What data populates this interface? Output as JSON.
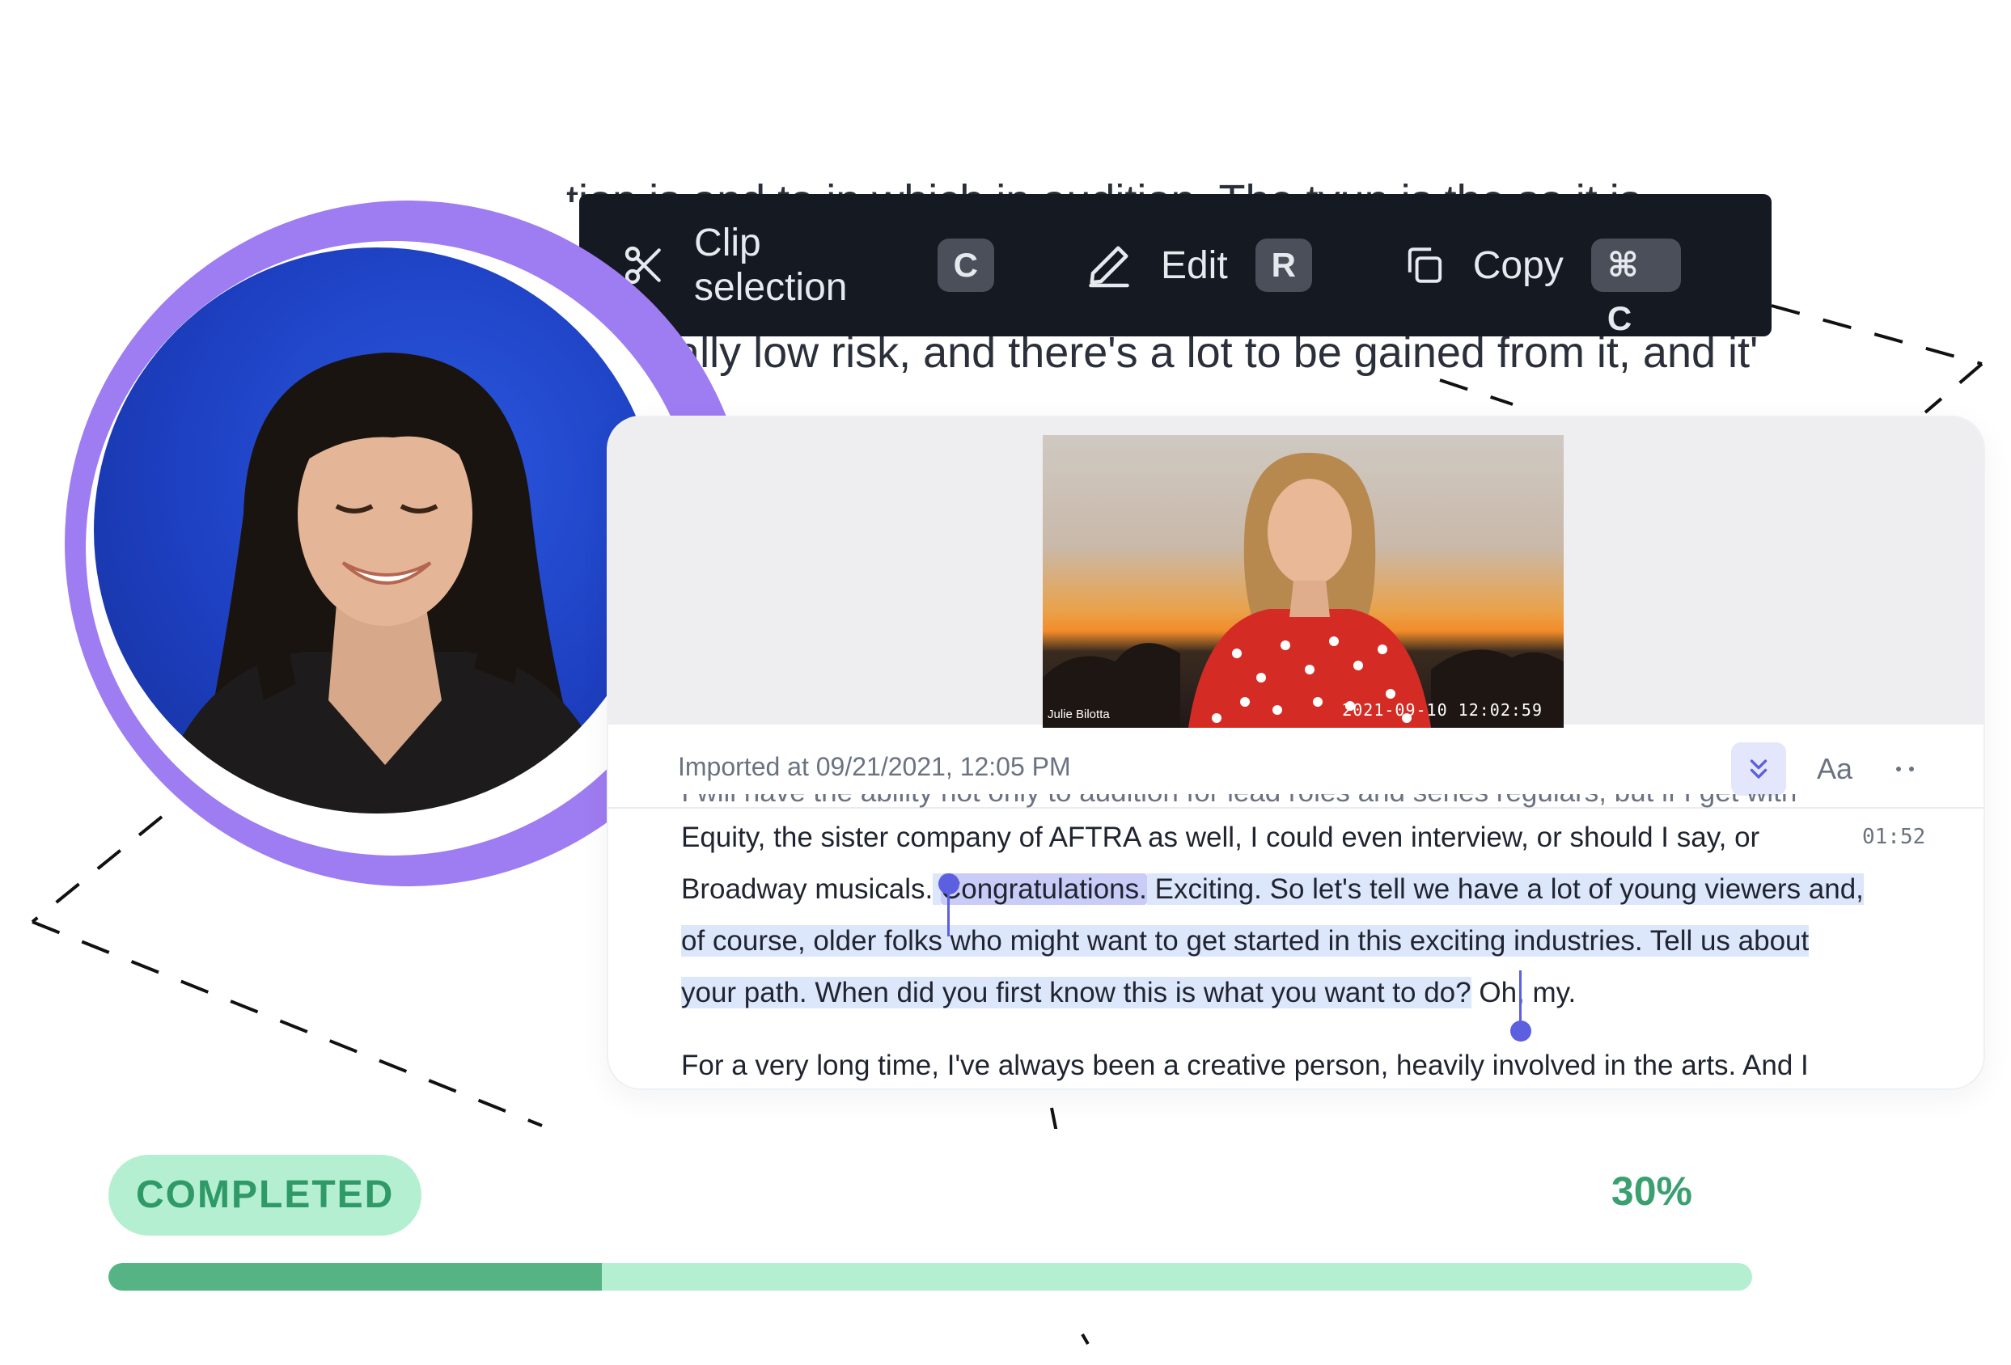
{
  "toolbar": {
    "items": [
      {
        "label": "Clip selection",
        "shortcut": "C",
        "icon": "scissors-icon"
      },
      {
        "label": "Edit",
        "shortcut": "R",
        "icon": "pencil-icon"
      },
      {
        "label": "Copy",
        "shortcut": "⌘ C",
        "icon": "copy-icon"
      }
    ]
  },
  "background_text": {
    "line": "s a really low risk, and there's a lot to be gained from it, and it'"
  },
  "video": {
    "speaker_name": "Julie Bilotta",
    "timestamp": "2021-09-10 12:02:59"
  },
  "editor": {
    "imported_label": "Imported at 09/21/2021, 12:05 PM",
    "font_button": "Aa",
    "line_partial": "I will have the ability not only to audition for lead roles and series regulars, but if I get with",
    "line1": "Equity, the sister company of AFTRA as well, I could even interview, or should I say, or",
    "line1_stamp": "01:52",
    "line2_pre": "Broadway musicals.",
    "line2_highlight": "Congratulations.",
    "line2_post": "Exciting. So let's tell we have a lot of young viewers and,",
    "line3": "of course, older folks who might want to get started in this exciting industries. Tell us about",
    "line4_selected": "your path. When did you first know this is what you want to do?",
    "line4_rest": "Oh, my.",
    "line5": "For a very long time, I've always been a creative person, heavily involved in the arts. And I"
  },
  "progress": {
    "status": "COMPLETED",
    "percent_label": "30%",
    "value": 0.3
  },
  "colors": {
    "toolbar_bg": "#141922",
    "accent": "#5b5fe0",
    "ring": "#9e7cf1",
    "progress_fill": "#56b384",
    "progress_track": "#b5efd2"
  }
}
